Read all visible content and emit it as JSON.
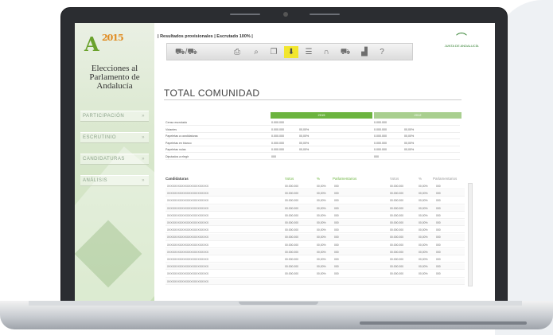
{
  "sidebar": {
    "logo_year": "2015",
    "site_title": "Elecciones al Parlamento de Andalucía",
    "nav": [
      {
        "label": "PARTICIPACIÓN"
      },
      {
        "label": "ESCRUTINIO"
      },
      {
        "label": "CANDIDATURAS"
      },
      {
        "label": "ANÁLISIS"
      }
    ]
  },
  "header": {
    "status_text": "| Resultados provisionales | Escrutado 100% |"
  },
  "toolbar": {
    "buttons": [
      {
        "icon": "map-icon",
        "glyph": "⛟/⛟"
      },
      {
        "icon": "print-icon",
        "glyph": "⎙"
      },
      {
        "icon": "zoom-icon",
        "glyph": "⌕"
      },
      {
        "icon": "copy-icon",
        "glyph": "❐"
      },
      {
        "icon": "download-icon",
        "glyph": "⬇",
        "active": true
      },
      {
        "icon": "list-icon",
        "glyph": "☰"
      },
      {
        "icon": "parliament-icon",
        "glyph": "∩"
      },
      {
        "icon": "region-map-icon",
        "glyph": "⛟"
      },
      {
        "icon": "bar-chart-icon",
        "glyph": "▟"
      },
      {
        "icon": "help-icon",
        "glyph": "?"
      }
    ]
  },
  "brand": {
    "junta_label": "JUNTA DE ANDALUCÍA"
  },
  "main": {
    "page_title": "TOTAL COMUNIDAD",
    "year_headers": [
      "2015",
      "2012"
    ],
    "summary_rows": [
      {
        "label": "Censo escrutado",
        "v1": "0.000.000",
        "p1": "",
        "v2": "0.000.000",
        "p2": ""
      },
      {
        "label": "Votantes",
        "v1": "0.000.000",
        "p1": "00,00%",
        "v2": "0.000.000",
        "p2": "00,00%"
      },
      {
        "label": "Papeletas a candidaturas",
        "v1": "0.000.000",
        "p1": "00,00%",
        "v2": "0.000.000",
        "p2": "00,00%"
      },
      {
        "label": "Papeletas en blanco",
        "v1": "0.000.000",
        "p1": "00,00%",
        "v2": "0.000.000",
        "p2": "00,00%"
      },
      {
        "label": "Papeletas nulas",
        "v1": "0.000.000",
        "p1": "00,00%",
        "v2": "0.000.000",
        "p2": "00,00%"
      },
      {
        "label": "Diputados a elegir",
        "v1": "000",
        "p1": "",
        "v2": "000",
        "p2": ""
      }
    ],
    "candidates_table": {
      "headers": [
        "Candidaturas",
        "Votos",
        "%",
        "Parlamentarios",
        "Votos",
        "%",
        "Parlamentarios"
      ],
      "rows": [
        [
          "XXXXXXXXXXXXXXXXXXXXXXX",
          "00.000.000",
          "00,00%",
          "000",
          "00.000.000",
          "00,00%",
          "000"
        ],
        [
          "XXXXXXXXXXXXXXXXXXXXXXX",
          "00.000.000",
          "00,00%",
          "000",
          "00.000.000",
          "00,00%",
          "000"
        ],
        [
          "XXXXXXXXXXXXXXXXXXXXXXX",
          "00.000.000",
          "00,00%",
          "000",
          "00.000.000",
          "00,00%",
          "000"
        ],
        [
          "XXXXXXXXXXXXXXXXXXXXXXX",
          "00.000.000",
          "00,00%",
          "000",
          "00.000.000",
          "00,00%",
          "000"
        ],
        [
          "XXXXXXXXXXXXXXXXXXXXXXX",
          "00.000.000",
          "00,00%",
          "000",
          "00.000.000",
          "00,00%",
          "000"
        ],
        [
          "XXXXXXXXXXXXXXXXXXXXXXX",
          "00.000.000",
          "00,00%",
          "000",
          "00.000.000",
          "00,00%",
          "000"
        ],
        [
          "XXXXXXXXXXXXXXXXXXXXXXX",
          "00.000.000",
          "00,00%",
          "000",
          "00.000.000",
          "00,00%",
          "000"
        ],
        [
          "XXXXXXXXXXXXXXXXXXXXXXX",
          "00.000.000",
          "00,00%",
          "000",
          "00.000.000",
          "00,00%",
          "000"
        ],
        [
          "XXXXXXXXXXXXXXXXXXXXXXX",
          "00.000.000",
          "00,00%",
          "000",
          "00.000.000",
          "00,00%",
          "000"
        ],
        [
          "XXXXXXXXXXXXXXXXXXXXXXX",
          "00.000.000",
          "00,00%",
          "000",
          "00.000.000",
          "00,00%",
          "000"
        ],
        [
          "XXXXXXXXXXXXXXXXXXXXXXX",
          "00.000.000",
          "00,00%",
          "000",
          "00.000.000",
          "00,00%",
          "000"
        ],
        [
          "XXXXXXXXXXXXXXXXXXXXXXX",
          "00.000.000",
          "00,00%",
          "000",
          "00.000.000",
          "00,00%",
          "000"
        ],
        [
          "XXXXXXXXXXXXXXXXXXXXXXX",
          "00.000.000",
          "00,00%",
          "000",
          "00.000.000",
          "00,00%",
          "000"
        ],
        [
          "XXXXXXXXXXXXXXXXXXXXXXX",
          "",
          "",
          "",
          "",
          "",
          ""
        ]
      ]
    }
  },
  "colors": {
    "accent_green": "#6cb43f",
    "header_light_green": "#a9cf8f",
    "toolbar_active": "#f2e62e"
  }
}
